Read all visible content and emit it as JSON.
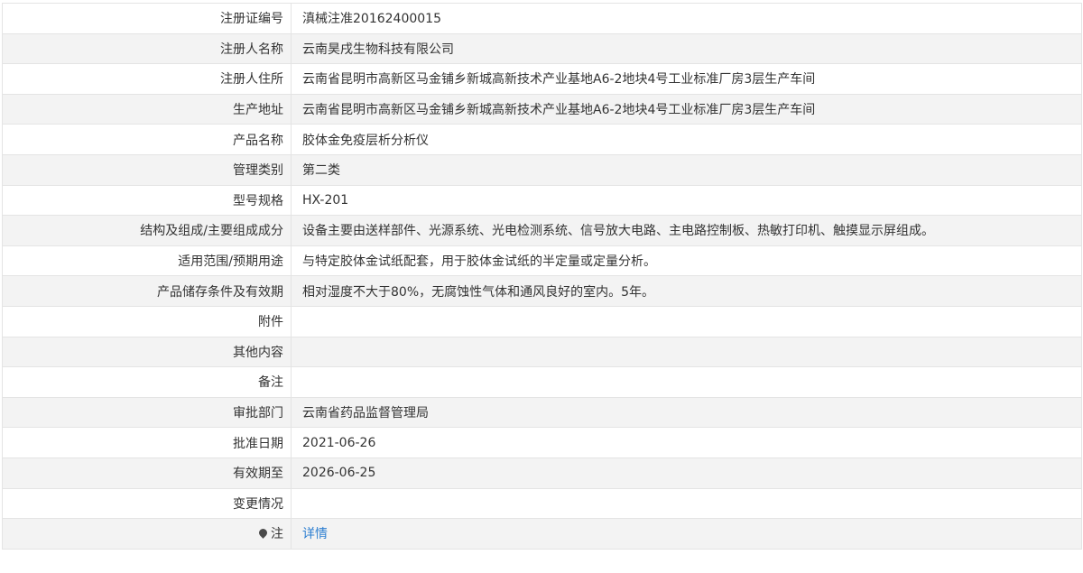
{
  "rows": [
    {
      "label": "注册证编号",
      "value": "滇械注准20162400015"
    },
    {
      "label": "注册人名称",
      "value": "云南昊戌生物科技有限公司"
    },
    {
      "label": "注册人住所",
      "value": "云南省昆明市高新区马金铺乡新城高新技术产业基地A6-2地块4号工业标准厂房3层生产车间"
    },
    {
      "label": "生产地址",
      "value": "云南省昆明市高新区马金铺乡新城高新技术产业基地A6-2地块4号工业标准厂房3层生产车间"
    },
    {
      "label": "产品名称",
      "value": "胶体金免疫层析分析仪"
    },
    {
      "label": "管理类别",
      "value": "第二类"
    },
    {
      "label": "型号规格",
      "value": "HX-201"
    },
    {
      "label": "结构及组成/主要组成成分",
      "value": "设备主要由送样部件、光源系统、光电检测系统、信号放大电路、主电路控制板、热敏打印机、触摸显示屏组成。"
    },
    {
      "label": "适用范围/预期用途",
      "value": "与特定胶体金试纸配套，用于胶体金试纸的半定量或定量分析。"
    },
    {
      "label": "产品储存条件及有效期",
      "value": "相对湿度不大于80%，无腐蚀性气体和通风良好的室内。5年。"
    },
    {
      "label": "附件",
      "value": ""
    },
    {
      "label": "其他内容",
      "value": ""
    },
    {
      "label": "备注",
      "value": ""
    },
    {
      "label": "审批部门",
      "value": "云南省药品监督管理局"
    },
    {
      "label": "批准日期",
      "value": "2021-06-26"
    },
    {
      "label": "有效期至",
      "value": "2026-06-25"
    },
    {
      "label": "变更情况",
      "value": ""
    }
  ],
  "note": {
    "label": "注",
    "link": "详情",
    "icon": "location-pin-icon"
  },
  "colors": {
    "link": "#2d7fd1",
    "stripe": "#f3f3f3",
    "border": "#e4e4e4"
  }
}
